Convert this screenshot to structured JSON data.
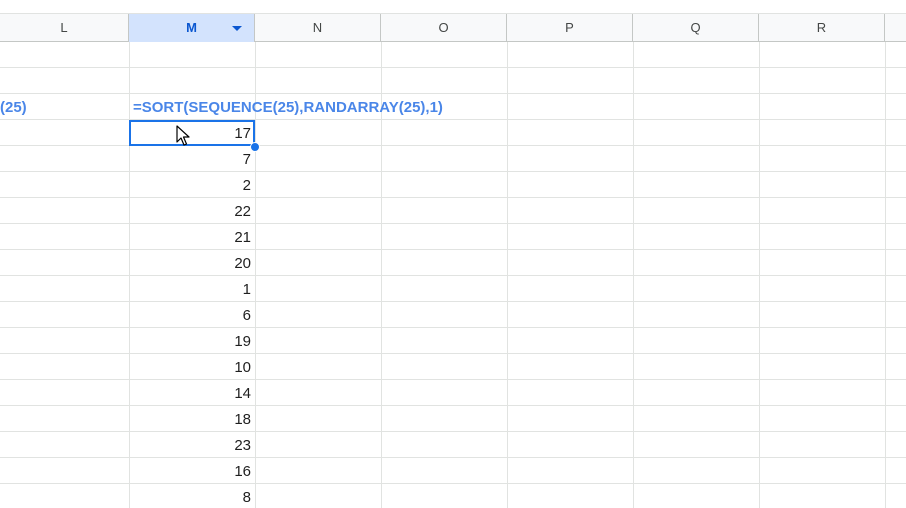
{
  "columns": [
    "L",
    "M",
    "N",
    "O",
    "P",
    "Q",
    "R"
  ],
  "selected_column": "M",
  "cells": {
    "l_partial": "(25)",
    "formula": "=SORT(SEQUENCE(25),RANDARRAY(25),1)"
  },
  "m_values": [
    "17",
    "7",
    "2",
    "22",
    "21",
    "20",
    "1",
    "6",
    "19",
    "10",
    "14",
    "18",
    "23",
    "16",
    "8"
  ],
  "colors": {
    "selection_blue": "#1a73e8",
    "header_selected_bg": "#d3e3fd",
    "formula_text": "#4a86e8"
  },
  "icons": [
    "chevron-down-icon",
    "mouse-pointer-icon",
    "fill-handle"
  ]
}
